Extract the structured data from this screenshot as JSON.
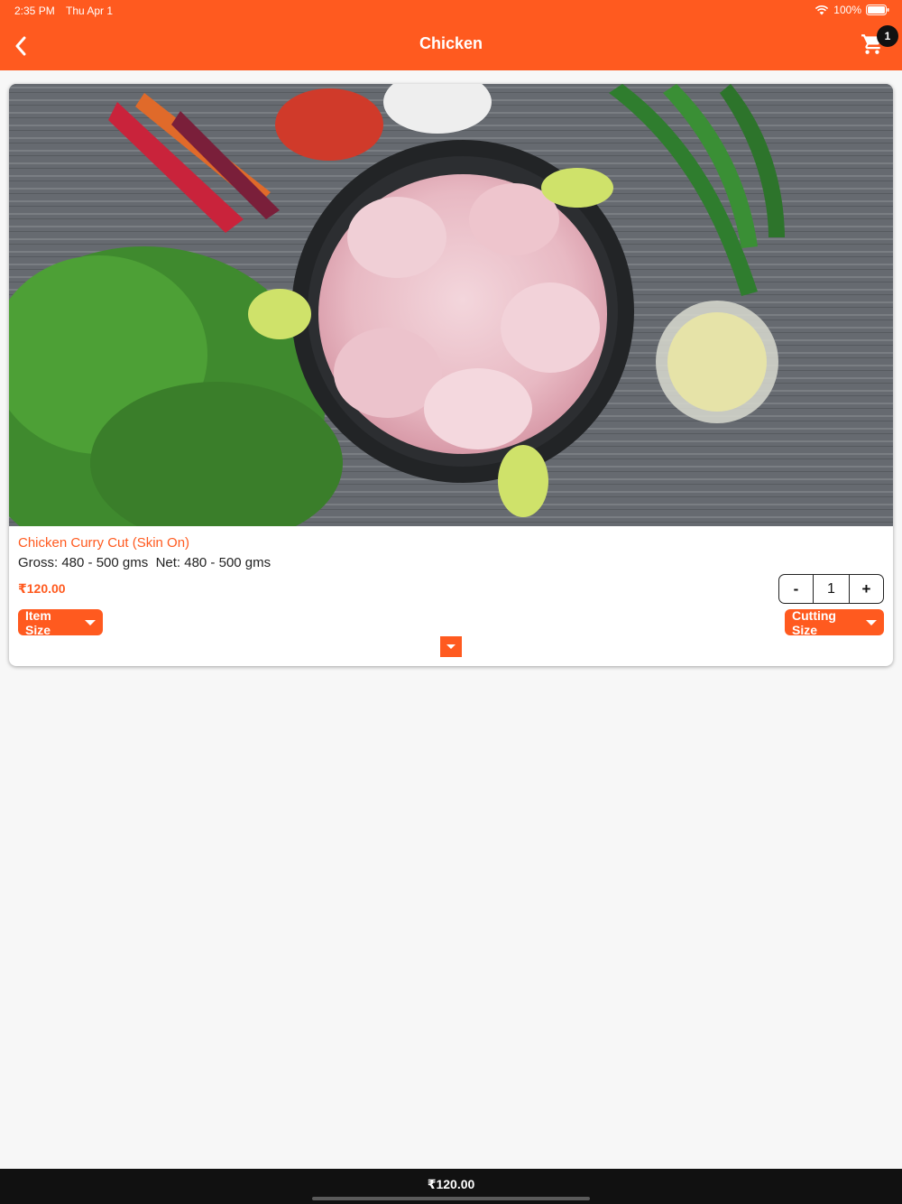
{
  "status_bar": {
    "time": "2:35 PM",
    "date": "Thu Apr 1",
    "battery": "100%"
  },
  "header": {
    "title": "Chicken",
    "cart_count": "1",
    "back_icon": "chevron-left-icon",
    "cart_icon": "cart-icon"
  },
  "product": {
    "name": "Chicken Curry Cut (Skin On)",
    "weight": "Gross: 480 - 500 gms  Net: 480 - 500 gms",
    "price": "₹120.00",
    "quantity": "1",
    "minus_label": "-",
    "plus_label": "+",
    "item_size_label": "Item Size",
    "cutting_size_label": "Cutting Size"
  },
  "footer": {
    "total": "₹120.00"
  },
  "colors": {
    "accent": "#ff5a1f",
    "footer": "#111111",
    "background": "#f7f7f7"
  }
}
